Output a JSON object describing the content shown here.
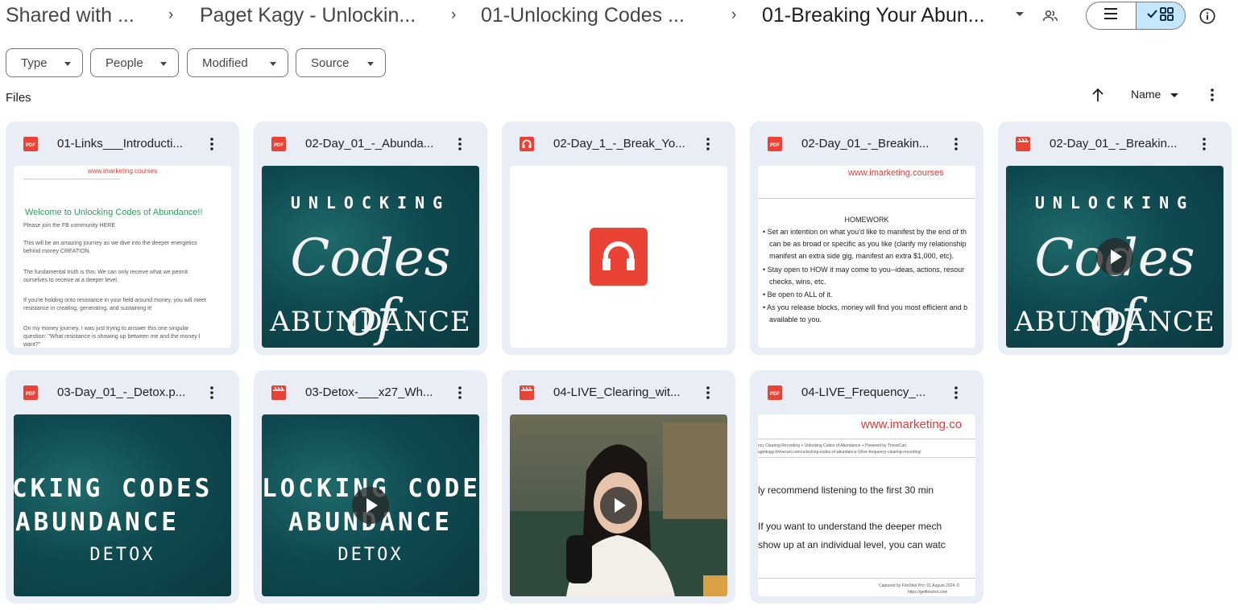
{
  "breadcrumb": {
    "items": [
      "Shared with ...",
      "Paget Kagy - Unlockin...",
      "01-Unlocking Codes ..."
    ],
    "current": "01-Breaking Your Abun..."
  },
  "filters": [
    "Type",
    "People",
    "Modified",
    "Source"
  ],
  "files_label": "Files",
  "sort_label": "Name",
  "cards": [
    {
      "title": "01-Links___Introducti...",
      "type": "pdf",
      "thumb": {
        "heading": "www.imarketing.courses",
        "title": "Welcome to Unlocking Codes of Abundance!!",
        "lines": [
          "Please join the FB community HERE",
          "This will be an amazing journey as we dive into the deeper energetics",
          "behind money CREATION.",
          "The fundamental truth is this: We can only receive what we permit",
          "ourselves to receive at a deeper level.",
          "If you're holding onto resistance in your field around money, you will meet",
          "resistance in creating, generating, and sustaining it!",
          "On my money journey, I was just trying to answer this one singular",
          "question: \"What resistance is showing up between me and the money I",
          "want?\""
        ]
      }
    },
    {
      "title": "02-Day_01_-_Abunda...",
      "type": "pdf",
      "thumb": {
        "top": "UNLOCKING",
        "mid": "Codes of",
        "bottom": "ABUNDANCE"
      }
    },
    {
      "title": "02-Day_1_-_Break_Yo...",
      "type": "audio"
    },
    {
      "title": "02-Day_01_-_Breakin...",
      "type": "pdf",
      "thumb": {
        "heading": "www.imarketing.courses",
        "subtitle": "HOMEWORK",
        "bullets": [
          "Set an intention on what you'd like to manifest by the end of th",
          "can be as broad or specific as you like (clarify my relationship",
          "manifest an extra side gig, manifest an extra $1,000, etc).",
          "Stay open to HOW it may come to you--ideas, actions, resour",
          "checks, wins, etc.",
          "Be open to ALL of it.",
          "As you release blocks, money will find you most efficient and b",
          "available to you."
        ]
      }
    },
    {
      "title": "02-Day_01_-_Breakin...",
      "type": "video",
      "thumb": {
        "top": "UNLOCKING",
        "mid": "Codes of",
        "bottom": "ABUNDANCE"
      }
    },
    {
      "title": "03-Day_01_-_Detox.p...",
      "type": "pdf",
      "thumb": {
        "top": "CKING CODES O",
        "mid": "ABUNDANCE",
        "bottom": "DETOX"
      }
    },
    {
      "title": "03-Detox-___x27_Wh...",
      "type": "video",
      "thumb": {
        "top": "LOCKING CODES",
        "mid": "ABUNDANCE",
        "bottom": "DETOX"
      }
    },
    {
      "title": "04-LIVE_Clearing_wit...",
      "type": "video"
    },
    {
      "title": "04-LIVE_Frequency_...",
      "type": "pdf",
      "thumb": {
        "heading": "www.imarketing.co",
        "line1": "ncy Clearing Recording + Unlocking Codes of Abundance + Powered by ThriveCart",
        "line2": "agetkagy.thrivecart.com/unlocking-codes-of-abundance-1/live-frequency-clearing-recording/",
        "big": [
          "ly recommend listening to the first 30 min",
          "If you want to understand the deeper mech",
          "show up at an individual level, you can watc"
        ],
        "footer": "Captured by FireShot Pro: 01 August 2024, 0",
        "footer2": "https://getfireshot.com"
      }
    }
  ],
  "colors": {
    "pdf": "#ea4335",
    "video": "#ea4335",
    "audio": "#ea4335",
    "card_bg": "#e9eef6",
    "toggle_active": "#c2e7ff"
  }
}
